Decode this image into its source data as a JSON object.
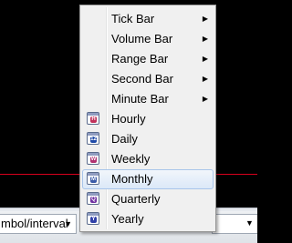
{
  "menu": {
    "submenu_items": [
      {
        "label": "Tick Bar",
        "arrow": "▶"
      },
      {
        "label": "Volume Bar",
        "arrow": "▶"
      },
      {
        "label": "Range Bar",
        "arrow": "▶"
      },
      {
        "label": "Second Bar",
        "arrow": "▶"
      },
      {
        "label": "Minute Bar",
        "arrow": "▶"
      }
    ],
    "period_items": [
      {
        "label": "Hourly",
        "icon": "calendar-hour-icon",
        "badge": "H",
        "color": "#c0305a"
      },
      {
        "label": "Daily",
        "icon": "calendar-day-icon",
        "badge": "12",
        "color": "#1f4aa8"
      },
      {
        "label": "Weekly",
        "icon": "calendar-week-icon",
        "badge": "W",
        "color": "#b03070"
      },
      {
        "label": "Monthly",
        "icon": "calendar-month-icon",
        "badge": "M",
        "color": "#3a5ba8",
        "highlighted": true
      },
      {
        "label": "Quarterly",
        "icon": "calendar-quarter-icon",
        "badge": "Q",
        "color": "#7030a0"
      },
      {
        "label": "Yearly",
        "icon": "calendar-year-icon",
        "badge": "Y",
        "color": "#3040a8"
      }
    ]
  },
  "toolbar": {
    "symbol_interval_text": "mbol/interval",
    "dropdown_arrow": "▼"
  },
  "colors": {
    "chart_background": "#000000",
    "chart_border_line": "#d6001c",
    "highlight": "#dbe8f8"
  }
}
